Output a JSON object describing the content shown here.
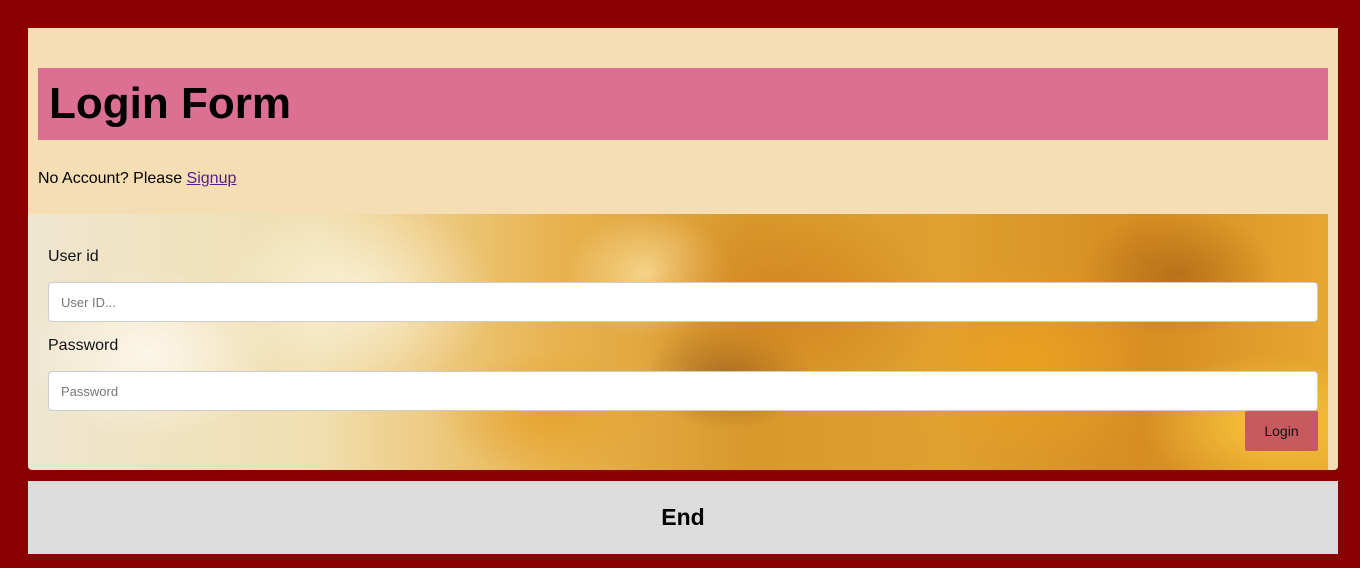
{
  "header": {
    "title": "Login Form"
  },
  "signup": {
    "prompt": "No Account? Please ",
    "link_label": "Signup"
  },
  "form": {
    "user_id_label": "User id",
    "user_id_placeholder": "User ID...",
    "user_id_value": "",
    "password_label": "Password",
    "password_placeholder": "Password",
    "password_value": "",
    "login_button_label": "Login"
  },
  "footer": {
    "text": "End"
  },
  "colors": {
    "page_background": "#8b0000",
    "header_panel": "#f5deb3",
    "title_bar": "#db7093",
    "login_button": "#c75a5f",
    "footer_background": "#dcdcdc",
    "link": "#551a8b"
  }
}
